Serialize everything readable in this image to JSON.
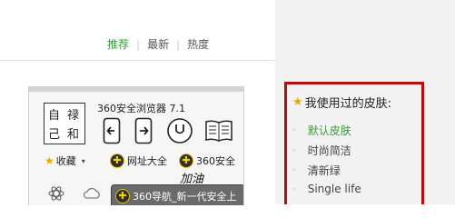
{
  "tabs": [
    {
      "label": "推荐",
      "active": true
    },
    {
      "label": "最新",
      "active": false
    },
    {
      "label": "热度",
      "active": false
    }
  ],
  "preview": {
    "browser_title": "360安全浏览器 7.1",
    "logo_chars": [
      "自",
      "禄",
      "己",
      "和"
    ],
    "favorites_label": "收藏",
    "nav_label": "网址大全",
    "safe_label": "360安全",
    "brush_text": "加油",
    "active_tab_title": "360导航_新一代安全上"
  },
  "skins_panel": {
    "title": "我使用过的皮肤:",
    "items": [
      {
        "label": "默认皮肤",
        "current": true
      },
      {
        "label": "时尚简洁",
        "current": false
      },
      {
        "label": "清新绿",
        "current": false
      },
      {
        "label": "Single life",
        "current": false
      }
    ]
  },
  "colors": {
    "accent_green": "#3b9a3b",
    "highlight_border": "#b30f0f",
    "panel_bg": "#f3f2f3"
  }
}
